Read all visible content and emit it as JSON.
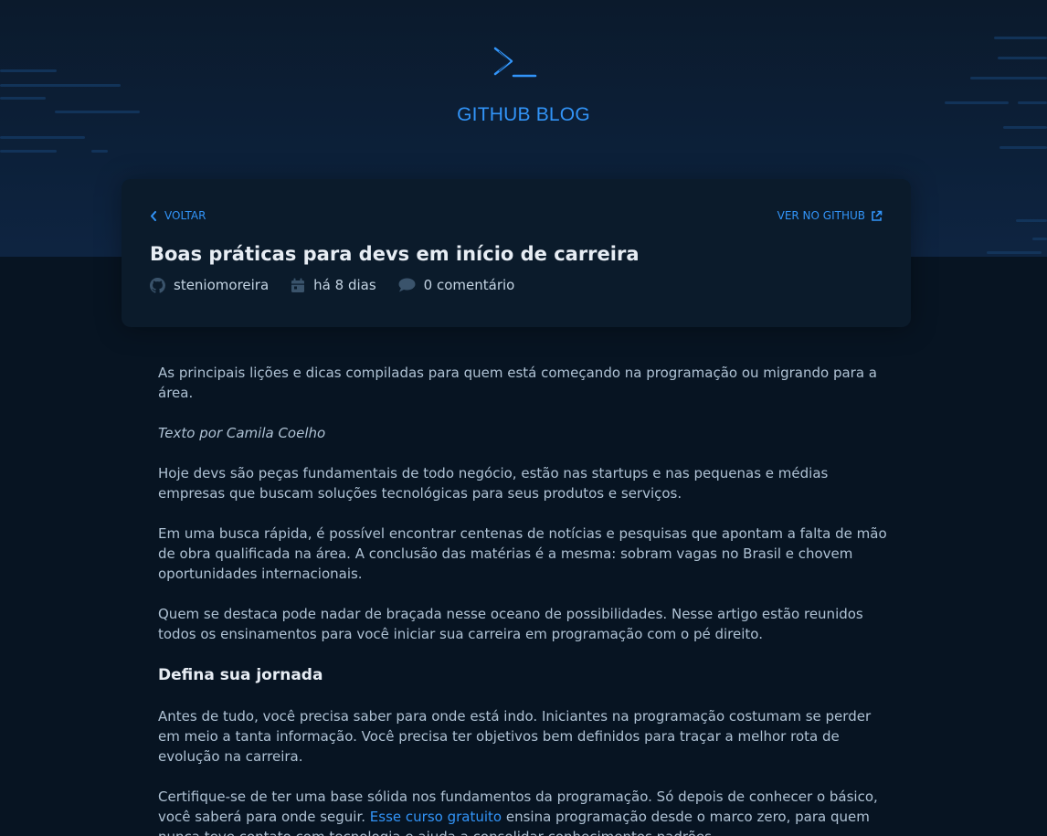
{
  "header": {
    "title": "GITHUB BLOG",
    "logo_icon": "terminal-prompt-icon"
  },
  "card": {
    "back_label": "VOLTAR",
    "github_label": "VER NO GITHUB",
    "title": "Boas práticas para devs em início de carreira",
    "meta": {
      "author": "steniomoreira",
      "date": "há 8 dias",
      "comments": "0 comentário"
    }
  },
  "article": {
    "intro": "As principais lições e dicas compiladas para quem está começando na programação ou migrando para a área.",
    "byline": "Texto por Camila Coelho",
    "p1": "Hoje devs são peças fundamentais de todo negócio, estão nas startups e nas pequenas e médias empresas que buscam soluções tecnológicas para seus produtos e serviços.",
    "p2": "Em uma busca rápida, é possível encontrar centenas de notícias e pesquisas que apontam a falta de mão de obra qualificada na área. A conclusão das matérias é a mesma: sobram vagas no Brasil e chovem oportunidades internacionais.",
    "p3": "Quem se destaca pode nadar de braçada nesse oceano de possibilidades. Nesse artigo estão reunidos todos os ensinamentos para você iniciar sua carreira em programação com o pé direito.",
    "heading": "Defina sua jornada",
    "p4": "Antes de tudo, você precisa saber para onde está indo. Iniciantes na programação costumam se perder em meio a tanta informação. Você precisa ter objetivos bem definidos para traçar a melhor rota de evolução na carreira.",
    "p5_before": "Certifique-se de ter uma base sólida nos fundamentos da programação. Só depois de conhecer o básico, você saberá para onde seguir. ",
    "p5_link": "Esse curso gratuito",
    "p5_after": " ensina programação desde o marco zero, para quem nunca teve contato com tecnologia e ajuda a consolidar conhecimentos padrões."
  },
  "colors": {
    "accent": "#3294F8",
    "background": "#071422",
    "card": "#0B1B2B"
  }
}
